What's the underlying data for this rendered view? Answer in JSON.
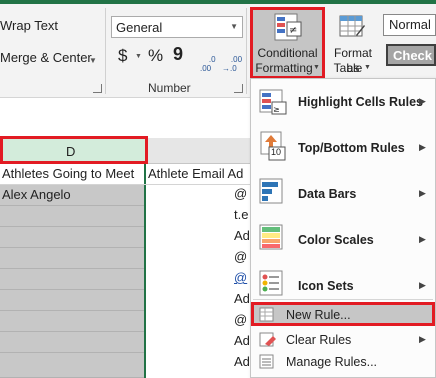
{
  "ribbon": {
    "wrap_text": "Wrap Text",
    "merge_center": "Merge & Center",
    "number_format": "General",
    "currency_symbol": "$",
    "percent_symbol": "%",
    "comma_symbol": "9",
    "increase_decimal": ".0\n.00",
    "decrease_decimal": ".00\n→.0",
    "number_group_label": "Number",
    "conditional_formatting_line1": "Conditional",
    "conditional_formatting_line2": "Formatting",
    "format_as_table_line1": "Format as",
    "format_as_table_line2": "Table",
    "style_normal": "Normal",
    "style_check_cell": "Check C"
  },
  "sheet": {
    "column_header": "D",
    "cells": {
      "header_d": "Athletes Going to Meet",
      "header_e": "Athlete Email Ad",
      "d_row1": "Alex Angelo",
      "email_partials": [
        "@",
        "t.e",
        "Ad",
        "@",
        "@",
        "Ad",
        "@",
        "Ad",
        "@",
        "Ad",
        "@",
        "Ad",
        "Address"
      ]
    }
  },
  "menu": {
    "items": [
      {
        "label": "Highlight Cells Rules",
        "underline": "H",
        "icon": "highlight-cells-icon",
        "submenu": true
      },
      {
        "label": "Top/Bottom Rules",
        "underline": "T",
        "icon": "top-bottom-icon",
        "submenu": true
      },
      {
        "label": "Data Bars",
        "underline": "D",
        "icon": "data-bars-icon",
        "submenu": true
      },
      {
        "label": "Color Scales",
        "underline": "S",
        "icon": "color-scales-icon",
        "submenu": true
      },
      {
        "label": "Icon Sets",
        "underline": "I",
        "icon": "icon-sets-icon",
        "submenu": true
      }
    ],
    "secondary": [
      {
        "label": "New Rule...",
        "icon": "new-rule-icon",
        "submenu": false
      },
      {
        "label": "Clear Rules",
        "icon": "clear-rules-icon",
        "submenu": true
      },
      {
        "label": "Manage Rules...",
        "icon": "manage-rules-icon",
        "submenu": false
      }
    ],
    "top_bottom_icon_number": "10"
  },
  "colors": {
    "excel_green": "#217346",
    "highlight_red": "#e21b23",
    "hover_gray": "#c6c6c6"
  }
}
